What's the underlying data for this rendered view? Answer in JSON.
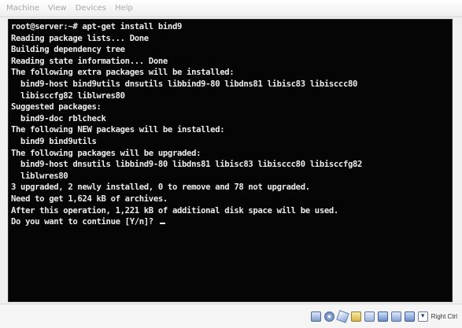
{
  "menubar": {
    "items": [
      "Machine",
      "View",
      "Devices",
      "Help"
    ]
  },
  "terminal": {
    "lines": [
      "root@server:~# apt-get install bind9",
      "Reading package lists... Done",
      "Building dependency tree",
      "Reading state information... Done",
      "The following extra packages will be installed:",
      "  bind9-host bind9utils dnsutils libbind9-80 libdns81 libisc83 libisccc80",
      "  libisccfg82 liblwres80",
      "Suggested packages:",
      "  bind9-doc rblcheck",
      "The following NEW packages will be installed:",
      "  bind9 bind9utils",
      "The following packages will be upgraded:",
      "  bind9-host dnsutils libbind9-80 libdns81 libisc83 libisccc80 libisccfg82",
      "  liblwres80",
      "3 upgraded, 2 newly installed, 0 to remove and 78 not upgraded.",
      "Need to get 1,624 kB of archives.",
      "After this operation, 1,221 kB of additional disk space will be used.",
      "Do you want to continue [Y/n]? "
    ]
  },
  "statusbar": {
    "host_key": "Right Ctrl"
  }
}
